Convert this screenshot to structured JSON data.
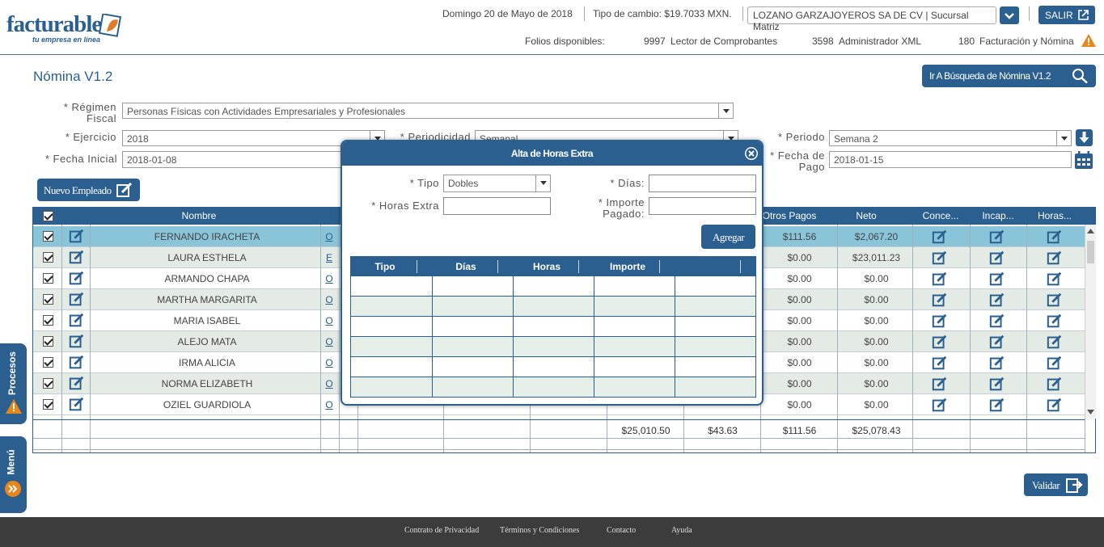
{
  "header": {
    "logo": "facturable",
    "tagline": "tu empresa en línea",
    "date": "Domingo 20 de Mayo de 2018",
    "exchange": "Tipo de cambio: $19.7033 MXN.",
    "company": "LOZANO GARZAJOYEROS SA DE CV | Sucursal Matriz",
    "logout": "SALIR",
    "folios_label": "Folios disponibles:",
    "folio1_count": "9997",
    "folio1_label": "Lector de Comprobantes",
    "folio2_count": "3598",
    "folio2_label": "Administrador XML",
    "folio3_count": "180",
    "folio3_label": "Facturación y Nómina"
  },
  "page": {
    "title": "Nómina V1.2",
    "search_button": "Ir A Búsqueda de  Nómina V1.2",
    "regimen_label1": "* Régimen",
    "regimen_label2": "Fiscal",
    "regimen_value": "Personas Físicas con Actividades Empresariales y Profesionales",
    "ejercicio_label": "* Ejercicio",
    "ejercicio_value": "2018",
    "periodicidad_label": "* Periodicidad",
    "periodicidad_value": "Semanal",
    "periodo_label": "* Periodo",
    "periodo_value": "Semana 2",
    "fecha_inicial_label": "* Fecha Inicial",
    "fecha_inicial_value": "2018-01-08",
    "fecha_pago_label1": "* Fecha de",
    "fecha_pago_label2": "Pago",
    "fecha_pago_value": "2018-01-15",
    "new_employee_button": "Nuevo Empleado",
    "validate_button": "Validar"
  },
  "grid": {
    "headers": {
      "nombre": "Nombre",
      "otros": "Otros Pagos",
      "neto": "Neto",
      "conce": "Conce...",
      "incap": "Incap...",
      "horas": "Horas..."
    },
    "rows": [
      {
        "nombre": "FERNANDO IRACHETA",
        "tipo": "O",
        "otros": "$111.56",
        "neto": "$2,067.20"
      },
      {
        "nombre": "LAURA ESTHELA",
        "tipo": "E",
        "otros": "$0.00",
        "neto": "$23,011.23"
      },
      {
        "nombre": "ARMANDO CHAPA",
        "tipo": "O",
        "otros": "$0.00",
        "neto": "$0.00"
      },
      {
        "nombre": "MARTHA MARGARITA",
        "tipo": "O",
        "otros": "$0.00",
        "neto": "$0.00"
      },
      {
        "nombre": "MARIA ISABEL",
        "tipo": "O",
        "otros": "$0.00",
        "neto": "$0.00"
      },
      {
        "nombre": "ALEJO MATA",
        "tipo": "O",
        "otros": "$0.00",
        "neto": "$0.00"
      },
      {
        "nombre": "IRMA ALICIA",
        "tipo": "O",
        "otros": "$0.00",
        "neto": "$0.00"
      },
      {
        "nombre": "NORMA ELIZABETH",
        "tipo": "O",
        "otros": "$0.00",
        "neto": "$0.00"
      },
      {
        "nombre": "OZIEL GUARDIOLA",
        "tipo": "O",
        "otros": "$0.00",
        "neto": "$0.00"
      }
    ],
    "totals": {
      "percepciones": "$25,010.50",
      "deducciones": "$43.63",
      "otros": "$111.56",
      "neto": "$25,078.43"
    }
  },
  "modal": {
    "title": "Alta de Horas Extra",
    "tipo_label": "* Tipo",
    "tipo_value": "Dobles",
    "dias_label": "* Días:",
    "horas_label": "* Horas Extra",
    "importe_label1": "* Importe",
    "importe_label2": "Pagado:",
    "add_button": "Agregar",
    "table_headers": [
      "Tipo",
      "Días",
      "Horas",
      "Importe",
      ""
    ]
  },
  "side": {
    "procesos": "Procesos",
    "menu": "Menú"
  },
  "footer": {
    "privacy": "Contrato de Privacidad",
    "terms": "Términos y Condiciones",
    "contact": "Contacto",
    "help": "Ayuda"
  }
}
